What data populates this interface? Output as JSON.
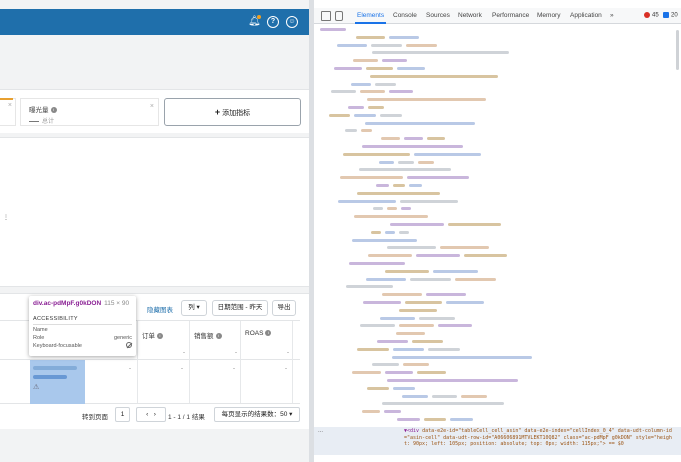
{
  "app": {
    "metric_label": "曝光量",
    "metric_sub": "总计",
    "add_metric_label": "添加指标",
    "table_toolbar": {
      "hide_chart": "隐藏图表",
      "columns": "列",
      "date_range": "日期范围 - 昨天",
      "export": "导出"
    },
    "columns": [
      "订单",
      "销售额",
      "ROAS"
    ],
    "dash": "-",
    "pagination": {
      "goto_label": "转到页面",
      "page_value": "1",
      "range": "1 - 1 / 1 结果",
      "page_size": "每页显示的结果数：50"
    },
    "tooltip": {
      "selector": "div.ac-pdMpF.g0kDON",
      "dims": "115 × 90",
      "section": "ACCESSIBILITY",
      "rows": [
        {
          "k": "Name",
          "v": ""
        },
        {
          "k": "Role",
          "v": "generic"
        },
        {
          "k": "Keyboard-focusable",
          "v": ""
        }
      ]
    }
  },
  "devtools": {
    "tabs": [
      "Elements",
      "Console",
      "Sources",
      "Network",
      "Performance",
      "Memory",
      "Application",
      "»"
    ],
    "active_tab": "Elements",
    "error_count": "45",
    "message_count": "20",
    "selected_node_gutter": "...",
    "selected_node_tag": "▼<div",
    "selected_node_attrs": "data-e2e-id=\"tableCell_cell_asin\" data-e2e-index=\"cellIndex_0_4\" data-udt-column-id=\"asin-cell\" data-udt-row-id=\"A06606891MTVLEKT10Q82\" class=\"ac-pdMpF g0kDON\" style=\"height: 90px; left: 105px; position: absolute; top: 0px; width: 115px;\"> == $0"
  },
  "colors": {
    "topbar": "#1f6fab",
    "highlight": "#a9c8ec",
    "devtools_accent": "#1a73e8",
    "tooltip_selector": "#8a2094"
  },
  "icons": [
    "bell-icon",
    "help-icon",
    "user-icon",
    "info-icon",
    "close-icon",
    "warning-icon",
    "inspect-icon",
    "device-icon",
    "no-entry-icon"
  ]
}
